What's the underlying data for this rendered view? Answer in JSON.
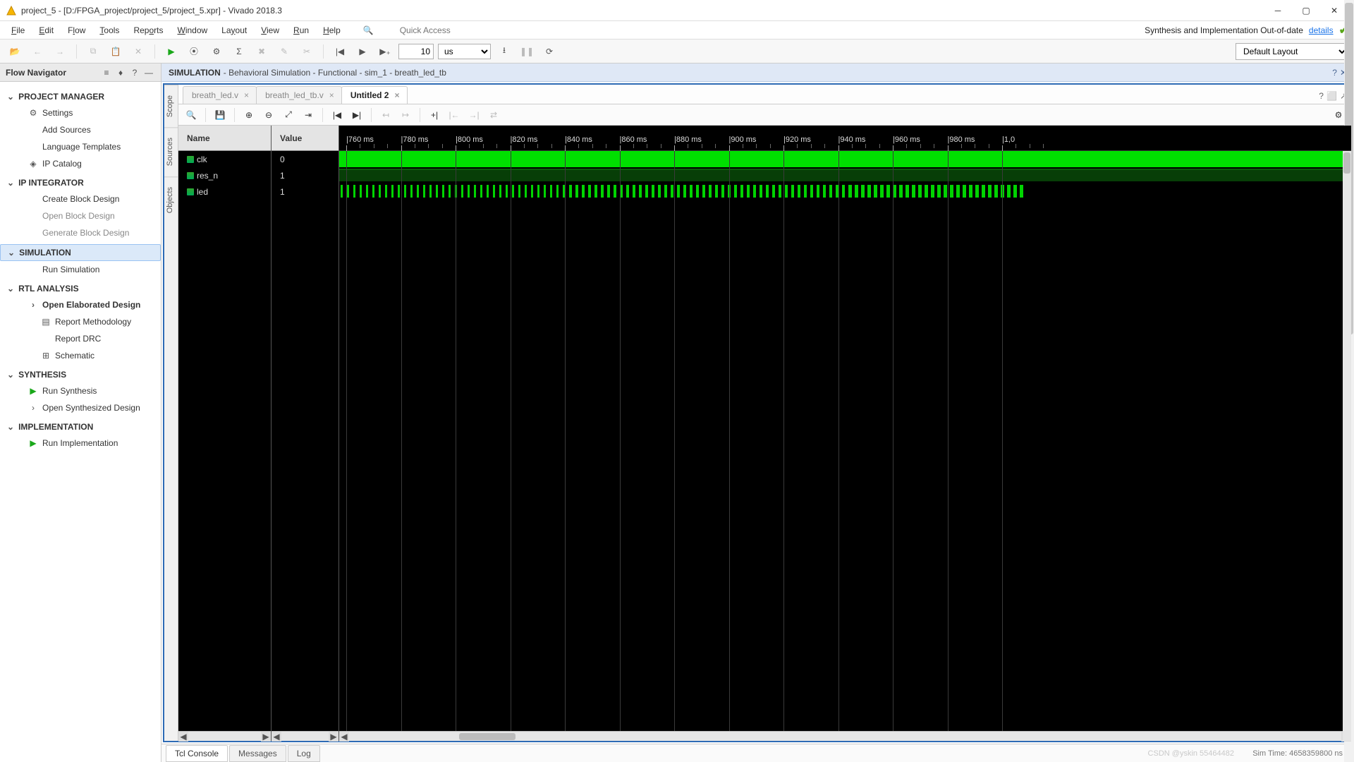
{
  "window": {
    "title": "project_5 - [D:/FPGA_project/project_5/project_5.xpr] - Vivado 2018.3"
  },
  "menu": {
    "items": [
      "File",
      "Edit",
      "Flow",
      "Tools",
      "Reports",
      "Window",
      "Layout",
      "View",
      "Run",
      "Help"
    ],
    "quick_access_placeholder": "Quick Access",
    "status_text": "Synthesis and Implementation Out-of-date",
    "details": "details"
  },
  "toolbar": {
    "time_value": "10",
    "time_unit": "us",
    "layout": "Default Layout"
  },
  "flow_navigator": {
    "title": "Flow Navigator",
    "sections": [
      {
        "title": "PROJECT MANAGER",
        "items": [
          {
            "label": "Settings",
            "icon": "gear-icon"
          },
          {
            "label": "Add Sources"
          },
          {
            "label": "Language Templates"
          },
          {
            "label": "IP Catalog",
            "icon": "ip-icon"
          }
        ]
      },
      {
        "title": "IP INTEGRATOR",
        "items": [
          {
            "label": "Create Block Design"
          },
          {
            "label": "Open Block Design",
            "disabled": true
          },
          {
            "label": "Generate Block Design",
            "disabled": true
          }
        ]
      },
      {
        "title": "SIMULATION",
        "selected": true,
        "items": [
          {
            "label": "Run Simulation"
          }
        ]
      },
      {
        "title": "RTL ANALYSIS",
        "items": [
          {
            "label": "Open Elaborated Design",
            "bold": true,
            "chev": true
          },
          {
            "label": "Report Methodology",
            "sub": true,
            "icon": "report-icon"
          },
          {
            "label": "Report DRC",
            "sub": true
          },
          {
            "label": "Schematic",
            "sub": true,
            "icon": "schematic-icon"
          }
        ]
      },
      {
        "title": "SYNTHESIS",
        "items": [
          {
            "label": "Run Synthesis",
            "icon": "play-green-icon"
          },
          {
            "label": "Open Synthesized Design",
            "chev": true
          }
        ]
      },
      {
        "title": "IMPLEMENTATION",
        "items": [
          {
            "label": "Run Implementation",
            "icon": "play-green-icon"
          }
        ]
      }
    ]
  },
  "simulation_panel": {
    "title_bold": "SIMULATION",
    "title_rest": " - Behavioral Simulation - Functional - sim_1 - breath_led_tb",
    "vtabs": [
      "Scope",
      "Sources",
      "Objects"
    ],
    "filetabs": [
      {
        "label": "breath_led.v",
        "active": false
      },
      {
        "label": "breath_led_tb.v",
        "active": false
      },
      {
        "label": "Untitled 2",
        "active": true
      }
    ],
    "columns": {
      "name": "Name",
      "value": "Value"
    },
    "signals": [
      {
        "name": "clk",
        "value": "0"
      },
      {
        "name": "res_n",
        "value": "1"
      },
      {
        "name": "led",
        "value": "1"
      }
    ],
    "ruler_ticks": [
      "760 ms",
      "780 ms",
      "800 ms",
      "820 ms",
      "840 ms",
      "860 ms",
      "880 ms",
      "900 ms",
      "920 ms",
      "940 ms",
      "960 ms",
      "980 ms",
      "1,0"
    ],
    "bottom_tabs": [
      "Tcl Console",
      "Messages",
      "Log"
    ],
    "sim_time": "Sim Time: 4658359800 ns",
    "watermark": "CSDN @yskin 55464482"
  }
}
